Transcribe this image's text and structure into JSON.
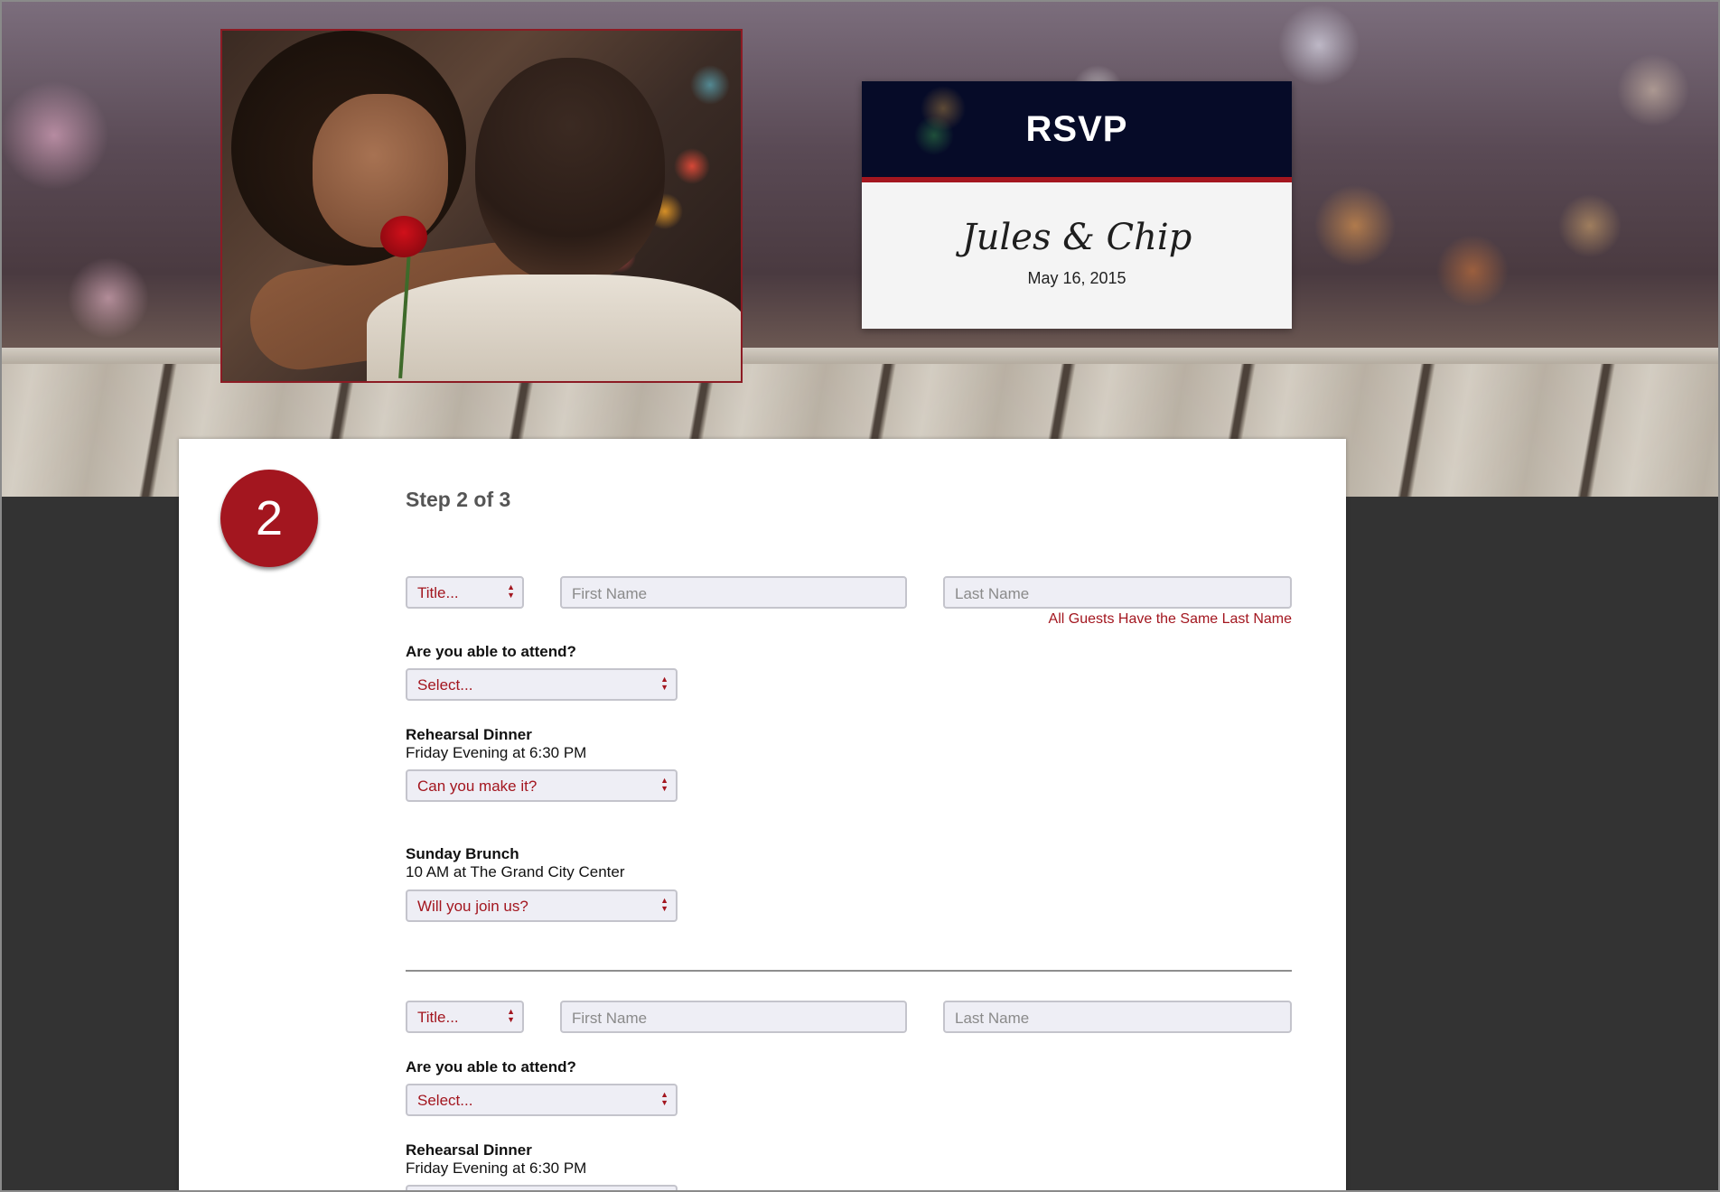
{
  "header": {
    "rsvp_title": "RSVP",
    "couple_names": "Jules & Chip",
    "event_date": "May 16, 2015"
  },
  "step": {
    "number": "2",
    "label": "Step 2 of 3"
  },
  "guests": [
    {
      "title_select": "Title...",
      "first_name_placeholder": "First Name",
      "last_name_placeholder": "Last Name",
      "last_name_hint": "All Guests Have the Same Last Name",
      "attend_question": "Are you able to attend?",
      "attend_select": "Select...",
      "rehearsal_title": "Rehearsal Dinner",
      "rehearsal_sub": "Friday Evening at 6:30 PM",
      "rehearsal_select": "Can you make it?",
      "brunch_title": "Sunday Brunch",
      "brunch_sub": "10 AM at The Grand City Center",
      "brunch_select": "Will you join us?"
    },
    {
      "title_select": "Title...",
      "first_name_placeholder": "First Name",
      "last_name_placeholder": "Last Name",
      "attend_question": "Are you able to attend?",
      "attend_select": "Select...",
      "rehearsal_title": "Rehearsal Dinner",
      "rehearsal_sub": "Friday Evening at 6:30 PM"
    }
  ],
  "icons": {
    "select_arrows": "up-down-arrows-icon"
  },
  "colors": {
    "accent": "#a3161f",
    "navy": "#060b28",
    "page_bg": "#333333",
    "field_bg": "#eeeef5"
  }
}
